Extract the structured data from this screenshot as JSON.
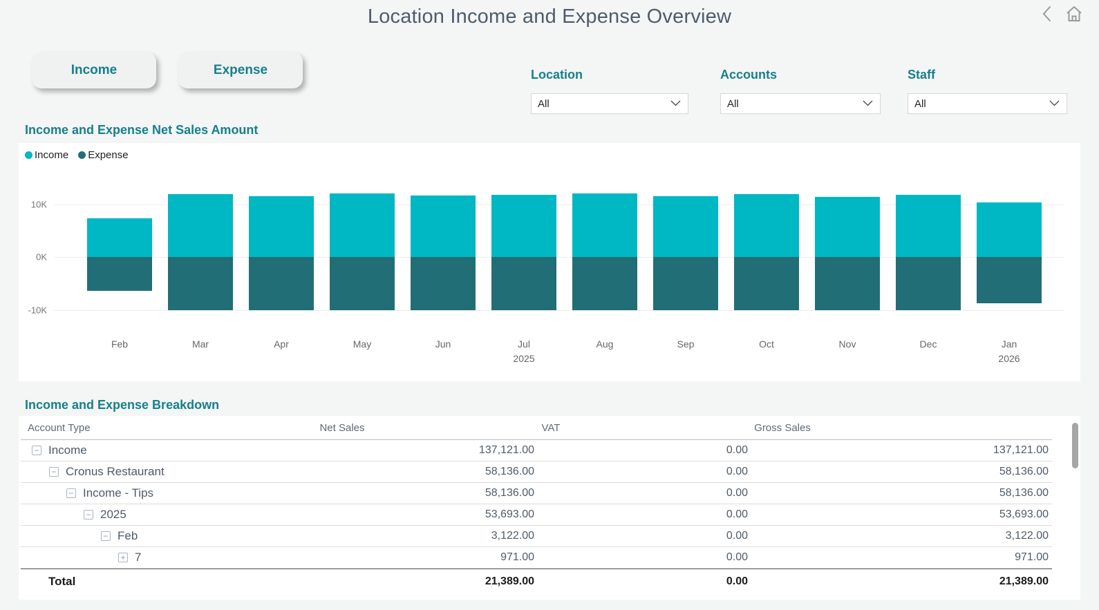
{
  "header": {
    "title": "Location Income and Expense Overview",
    "icons": [
      "back-chevron",
      "home"
    ]
  },
  "buttons": [
    {
      "label": "Income"
    },
    {
      "label": "Expense"
    }
  ],
  "filters": [
    {
      "label": "Location",
      "value": "All"
    },
    {
      "label": "Accounts",
      "value": "All"
    },
    {
      "label": "Staff",
      "value": "All"
    }
  ],
  "chart": {
    "heading": "Income and Expense Net Sales Amount",
    "legend": [
      {
        "label": "Income",
        "color": "#00b7c4"
      },
      {
        "label": "Expense",
        "color": "#226e76"
      }
    ]
  },
  "chart_data": {
    "type": "bar",
    "stacked": true,
    "title": "Income and Expense Net Sales Amount",
    "categories": [
      "Feb",
      "Mar",
      "Apr",
      "May",
      "Jun",
      "Jul",
      "Aug",
      "Sep",
      "Oct",
      "Nov",
      "Dec",
      "Jan"
    ],
    "year_labels": {
      "Jul": "2025",
      "Jan": "2026"
    },
    "series": [
      {
        "name": "Income",
        "color": "#00b7c4",
        "values": [
          7300,
          11900,
          11500,
          12000,
          11600,
          11800,
          12000,
          11500,
          11900,
          11400,
          11800,
          10300
        ]
      },
      {
        "name": "Expense",
        "color": "#226e76",
        "values": [
          -6400,
          -10100,
          -10100,
          -10100,
          -10100,
          -10100,
          -10100,
          -10100,
          -10100,
          -10100,
          -10100,
          -8700
        ]
      }
    ],
    "yticks": [
      {
        "label": "10K",
        "value": 10000
      },
      {
        "label": "0K",
        "value": 0
      },
      {
        "label": "-10K",
        "value": -10000
      }
    ],
    "ylim": [
      -11500,
      13500
    ],
    "grid": true,
    "legend_position": "top-left",
    "xlabel": "",
    "ylabel": ""
  },
  "table": {
    "heading": "Income and Expense Breakdown",
    "columns": [
      "Account Type",
      "Net Sales",
      "VAT",
      "Gross Sales"
    ],
    "rows": [
      {
        "indent": 0,
        "toggle": "minus",
        "label": "Income",
        "net": "137,121.00",
        "vat": "0.00",
        "gross": "137,121.00"
      },
      {
        "indent": 1,
        "toggle": "minus",
        "label": "Cronus Restaurant",
        "net": "58,136.00",
        "vat": "0.00",
        "gross": "58,136.00"
      },
      {
        "indent": 2,
        "toggle": "minus",
        "label": "Income - Tips",
        "net": "58,136.00",
        "vat": "0.00",
        "gross": "58,136.00"
      },
      {
        "indent": 3,
        "toggle": "minus",
        "label": "2025",
        "net": "53,693.00",
        "vat": "0.00",
        "gross": "53,693.00"
      },
      {
        "indent": 4,
        "toggle": "minus",
        "label": "Feb",
        "net": "3,122.00",
        "vat": "0.00",
        "gross": "3,122.00"
      },
      {
        "indent": 5,
        "toggle": "plus",
        "label": "7",
        "net": "971.00",
        "vat": "0.00",
        "gross": "971.00"
      }
    ],
    "total": {
      "label": "Total",
      "net": "21,389.00",
      "vat": "0.00",
      "gross": "21,389.00"
    }
  },
  "colors": {
    "accent": "#15808c",
    "income": "#00b7c4",
    "expense": "#226e76",
    "title_text": "#4e5c6b",
    "page_bg": "#f4f5f5"
  }
}
